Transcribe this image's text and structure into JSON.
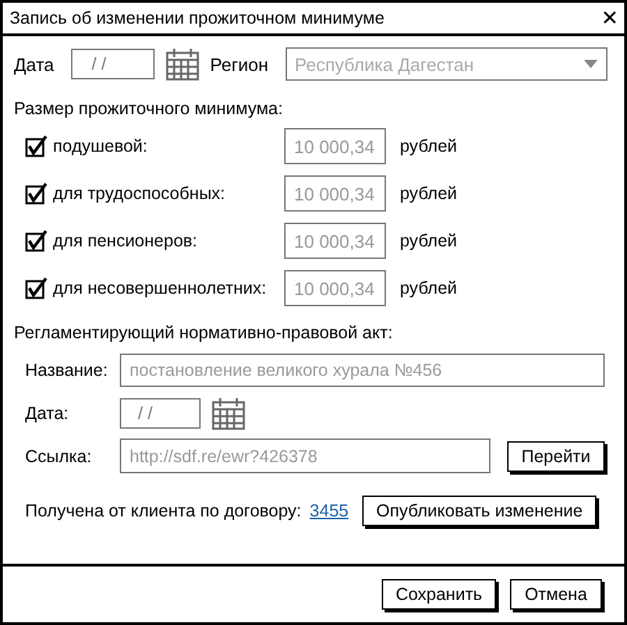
{
  "window": {
    "title": "Запись об изменении прожиточном минимуме",
    "close": "✕"
  },
  "date": {
    "label": "Дата",
    "value": "/ /"
  },
  "region": {
    "label": "Регион",
    "value": "Республика Дагестан"
  },
  "amounts": {
    "label": "Размер прожиточного минимума:",
    "rows": [
      {
        "label": "подушевой:",
        "checked": true,
        "value": "10 000,34",
        "unit": "рублей"
      },
      {
        "label": "для трудоспособных:",
        "checked": true,
        "value": "10 000,34",
        "unit": "рублей"
      },
      {
        "label": "для пенсионеров:",
        "checked": true,
        "value": "10 000,34",
        "unit": "рублей"
      },
      {
        "label": "для несовершеннолетних:",
        "checked": true,
        "value": "10 000,34",
        "unit": "рублей"
      }
    ]
  },
  "act": {
    "label": "Регламентирующий нормативно-правовой акт:",
    "name": {
      "label": "Название:",
      "value": "постановление великого хурала №456"
    },
    "date": {
      "label": "Дата:",
      "value": "/ /"
    },
    "link": {
      "label": "Ссылка:",
      "value": "http://sdf.re/ewr?426378",
      "button": "Перейти"
    }
  },
  "contract": {
    "label": "Получена от клиента по договору:",
    "link": "3455",
    "button": "Опубликовать изменение"
  },
  "buttons": [
    "Сохранить",
    "Отмена"
  ]
}
